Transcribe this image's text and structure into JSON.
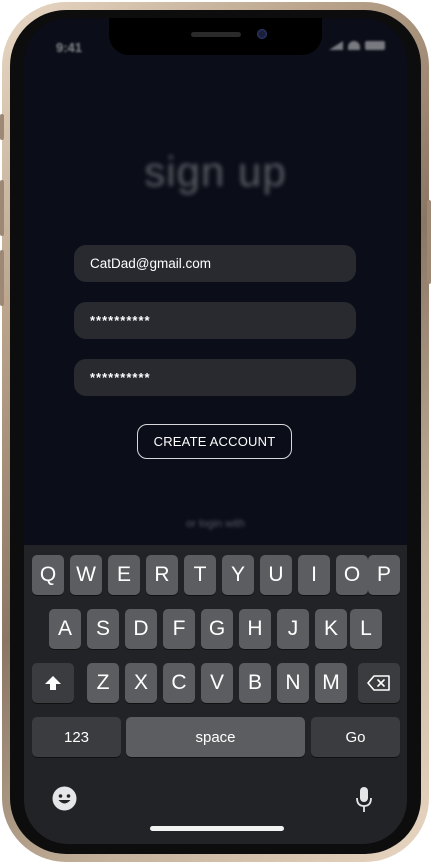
{
  "status_bar": {
    "time": "9:41"
  },
  "signup": {
    "title": "sign up",
    "email_value": "CatDad@gmail.com",
    "password_value": "**********",
    "confirm_value": "**********",
    "create_button": "CREATE ACCOUNT",
    "login_with": "or login with"
  },
  "keyboard": {
    "row1": [
      "Q",
      "W",
      "E",
      "R",
      "T",
      "Y",
      "U",
      "I",
      "O",
      "P"
    ],
    "row2": [
      "A",
      "S",
      "D",
      "F",
      "G",
      "H",
      "J",
      "K",
      "L"
    ],
    "row3": [
      "Z",
      "X",
      "C",
      "V",
      "B",
      "N",
      "M"
    ],
    "numbers_key": "123",
    "space_key": "space",
    "go_key": "Go",
    "shift_icon": "shift-icon",
    "delete_icon": "backspace-icon",
    "emoji_icon": "emoji-icon",
    "mic_icon": "microphone-icon"
  }
}
